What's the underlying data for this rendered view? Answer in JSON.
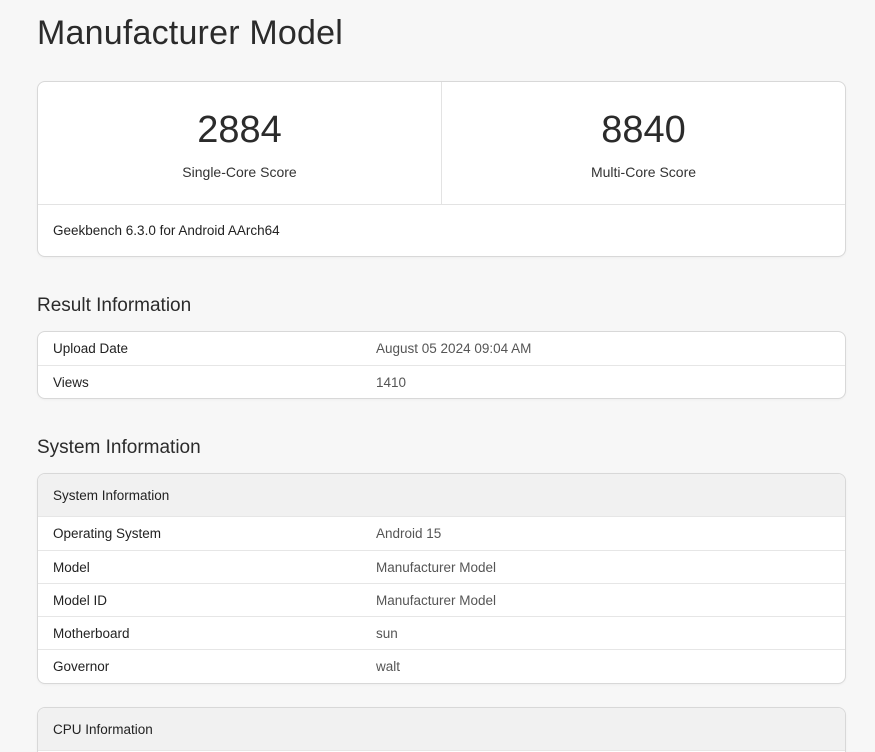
{
  "page": {
    "title": "Manufacturer Model"
  },
  "scores": {
    "single_core": {
      "value": "2884",
      "label": "Single-Core Score"
    },
    "multi_core": {
      "value": "8840",
      "label": "Multi-Core Score"
    },
    "footer": "Geekbench 6.3.0 for Android AArch64"
  },
  "result_information": {
    "title": "Result Information",
    "rows": [
      {
        "key": "Upload Date",
        "value": "August 05 2024 09:04 AM"
      },
      {
        "key": "Views",
        "value": "1410"
      }
    ]
  },
  "system_information": {
    "title": "System Information",
    "table_header": "System Information",
    "rows": [
      {
        "key": "Operating System",
        "value": "Android 15"
      },
      {
        "key": "Model",
        "value": "Manufacturer Model"
      },
      {
        "key": "Model ID",
        "value": "Manufacturer Model"
      },
      {
        "key": "Motherboard",
        "value": "sun"
      },
      {
        "key": "Governor",
        "value": "walt"
      }
    ]
  },
  "cpu_information": {
    "table_header": "CPU Information"
  }
}
